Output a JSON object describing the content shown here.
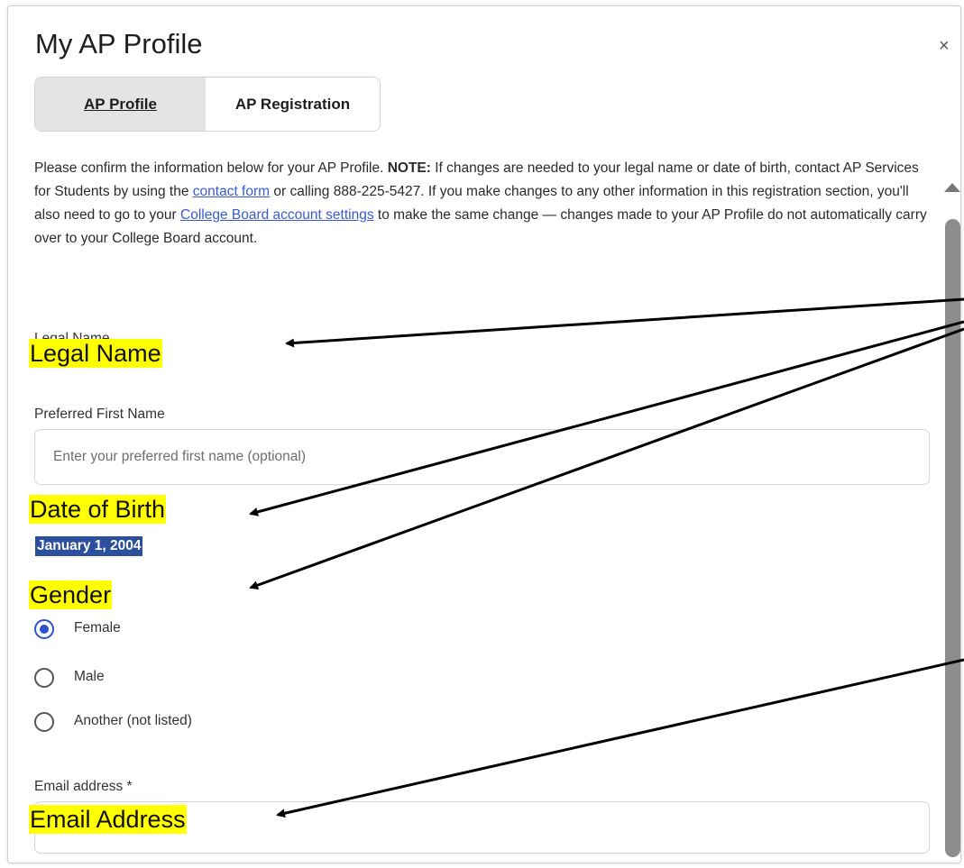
{
  "dialog": {
    "title": "My AP Profile",
    "close_label": "×",
    "tabs": [
      {
        "label": "AP Profile",
        "active": true
      },
      {
        "label": "AP Registration",
        "active": false
      }
    ]
  },
  "intro": {
    "part1": "Please confirm the information below for your AP Profile. ",
    "note_label": "NOTE:",
    "part2": " If changes are needed to your legal name or date of birth, contact AP Services for Students by using the ",
    "contact_link": "contact form",
    "part3": " or calling 888-225-5427. If you make changes to any other information in this registration section, you'll also need to go to your ",
    "settings_link": "College Board account settings",
    "part4": " to make the same change — changes made to your AP Profile do not automatically carry over to your College Board account."
  },
  "form": {
    "legal_name_label": "Legal Name",
    "preferred_first_name_label": "Preferred First Name",
    "preferred_first_name_placeholder": "Enter your preferred first name (optional)",
    "preferred_first_name_value": "",
    "date_of_birth_value": "January 1, 2004",
    "gender_options": [
      {
        "label": "Female",
        "checked": true
      },
      {
        "label": "Male",
        "checked": false
      },
      {
        "label": "Another (not listed)",
        "checked": false
      }
    ],
    "email_label": "Email address *",
    "email_value": ""
  },
  "annotations": {
    "legal_name": "Legal Name",
    "date_of_birth": "Date of Birth",
    "gender": "Gender",
    "email_address": "Email Address",
    "highlight_color": "#ffff00",
    "arrow_color": "#000000"
  },
  "colors": {
    "link": "#3a5bd6",
    "radio_selected": "#2d55c9",
    "selection_highlight": "#2b4f9c"
  }
}
